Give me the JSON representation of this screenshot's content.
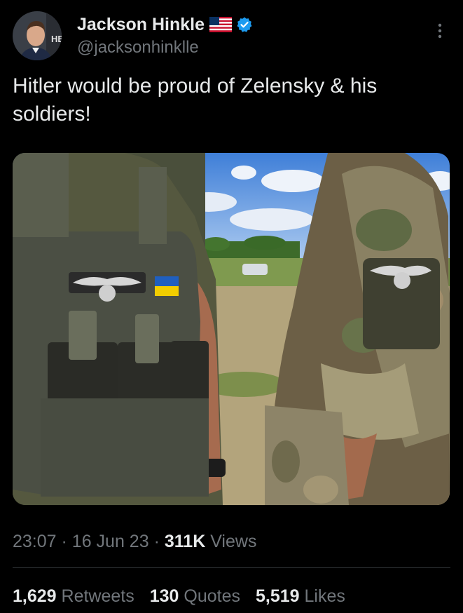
{
  "tweet": {
    "author": {
      "display_name": "Jackson Hinkle",
      "handle": "@jacksonhinklle",
      "flag_icon": "us-flag-icon",
      "verified_icon": "verified-badge-icon",
      "verified_color": "#1d9bf0"
    },
    "text": "Hitler would be proud of Zelensky & his soldiers!",
    "more_icon": "more-vertical-icon",
    "meta": {
      "time": "23:07",
      "separator1": "·",
      "date": "16 Jun 23",
      "separator2": "·",
      "views_count": "311K",
      "views_label": "Views"
    },
    "stats": {
      "retweets_count": "1,629",
      "retweets_label": "Retweets",
      "quotes_count": "130",
      "quotes_label": "Quotes",
      "likes_count": "5,519",
      "likes_label": "Likes"
    }
  },
  "colors": {
    "background": "#000000",
    "primary_text": "#e7e9ea",
    "secondary_text": "#71767b",
    "divider": "#2f3336"
  }
}
